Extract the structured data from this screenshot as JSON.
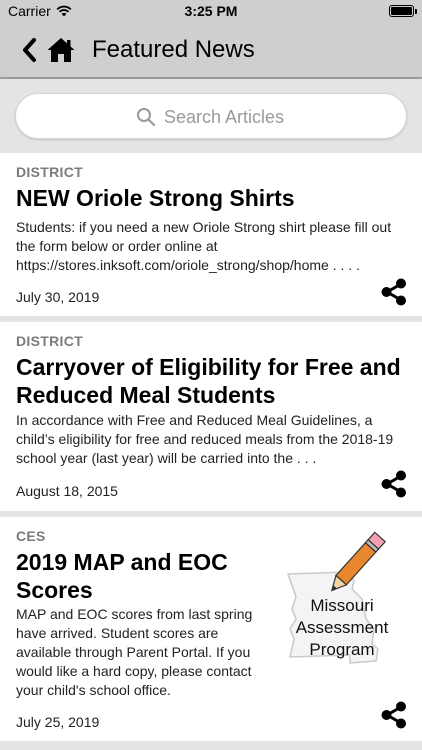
{
  "status_bar": {
    "carrier": "Carrier",
    "time": "3:25 PM"
  },
  "nav": {
    "title": "Featured News",
    "back_icon": "chevron-left-icon",
    "home_icon": "home-icon"
  },
  "search": {
    "placeholder": "Search Articles"
  },
  "articles": [
    {
      "category": "DISTRICT",
      "title": "NEW Oriole Strong Shirts",
      "summary": "Students:  if you need a new Oriole Strong shirt please fill out the form below or order online at https://stores.inksoft.com/oriole_strong/shop/home .  . . .",
      "date": "July 30, 2019"
    },
    {
      "category": "DISTRICT",
      "title": "Carryover of Eligibility for Free and Reduced Meal Students",
      "summary": "In accordance with Free and Reduced Meal Guidelines, a child’s eligibility for free and reduced meals from the 2018-19 school year (last year) will be carried into the . . .",
      "date": "August 18, 2015"
    },
    {
      "category": "CES",
      "title": "2019 MAP and EOC Scores",
      "summary": "MAP and EOC scores from last spring have arrived. Student scores are available through Parent Portal. If you would like a hard copy, please contact your child's school office.",
      "date": "July 25, 2019",
      "thumbnail": {
        "lines": [
          "Missouri",
          "Assessment",
          "Program"
        ]
      }
    }
  ],
  "colors": {
    "header_bg": "#cfcfcf",
    "page_bg": "#e4e4e4",
    "category_text": "#7b7b7b",
    "pencil": "#e8872e"
  }
}
